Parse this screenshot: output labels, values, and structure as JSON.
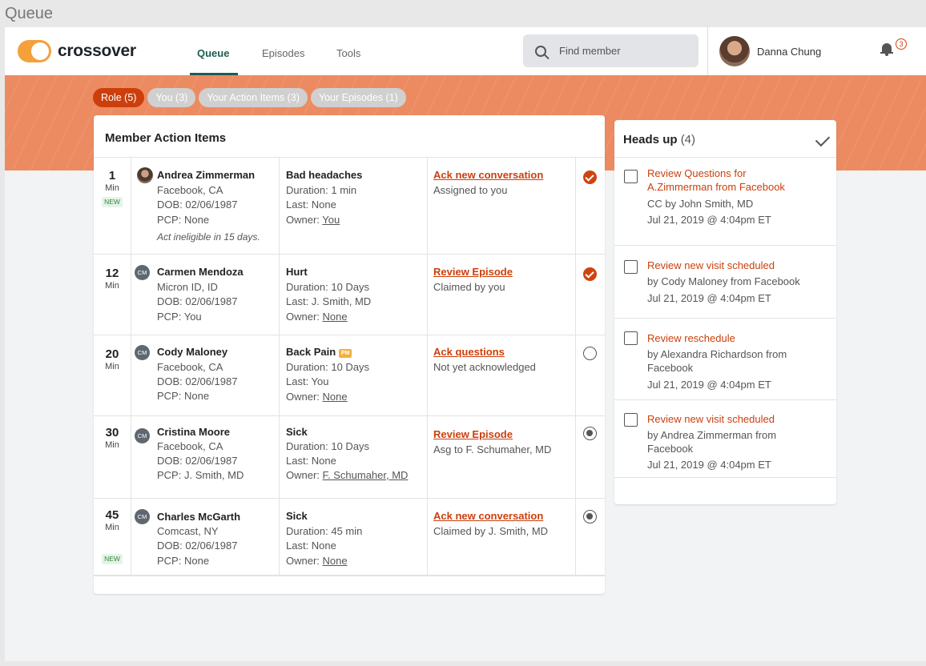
{
  "window_title": "Queue",
  "brand": {
    "name": "crossover",
    "accent": "#cc3f0c",
    "logo_color": "#f4a03b"
  },
  "nav": {
    "tabs": [
      {
        "label": "Queue",
        "active": true
      },
      {
        "label": "Episodes"
      },
      {
        "label": "Tools"
      }
    ]
  },
  "search": {
    "placeholder": "Find member"
  },
  "user": {
    "name": "Danna Chung"
  },
  "notifications": {
    "count": "3"
  },
  "filters": [
    {
      "label": "Role (5)",
      "active": true
    },
    {
      "label": "You (3)"
    },
    {
      "label": "Your Action Items (3)"
    },
    {
      "label": "Your Episodes (1)"
    }
  ],
  "main": {
    "title": "Member Action Items",
    "rows": [
      {
        "time": "1",
        "unit": "Min",
        "new": "NEW",
        "avatar": "photo",
        "name": "Andrea Zimmerman",
        "location": "Facebook, CA",
        "dob": "DOB: 02/06/1987",
        "pcp_label": "PCP: ",
        "pcp_value": "None",
        "note": "Act ineligible in 15 days.",
        "episode": "Bad headaches",
        "duration": "Duration: 1 min",
        "last": "Last: None",
        "owner_label": "Owner: ",
        "owner_value": "You",
        "action": "Ack new conversation",
        "action_status": "Assigned to you",
        "state": "done"
      },
      {
        "time": "12",
        "unit": "Min",
        "avatar": "CM",
        "name": "Carmen Mendoza",
        "location": "Micron ID, ID",
        "dob": "DOB: 02/06/1987",
        "pcp_label": "PCP: ",
        "pcp_value": "You",
        "episode": "Hurt",
        "duration": "Duration: 10 Days",
        "last": "Last: J. Smith, MD",
        "owner_label": "Owner: ",
        "owner_value": "None",
        "action": "Review Episode",
        "action_status": "Claimed by you",
        "state": "done"
      },
      {
        "time": "20",
        "unit": "Min",
        "avatar": "CM",
        "name": "Cody Maloney",
        "location": "Facebook, CA",
        "dob": "DOB: 02/06/1987",
        "pcp_label": "PCP: ",
        "pcp_value": "None",
        "episode": "Back Pain",
        "episode_badge": "PM",
        "duration": "Duration: 10 Days",
        "last": "Last: You",
        "owner_label": "Owner: ",
        "owner_value": "None",
        "action": "Ack questions",
        "action_status": "Not yet acknowledged",
        "state": "empty"
      },
      {
        "time": "30",
        "unit": "Min",
        "avatar": "CM",
        "name": "Cristina Moore",
        "location": "Facebook, CA",
        "dob": "DOB: 02/06/1987",
        "pcp_label": "PCP: ",
        "pcp_value": "J. Smith, MD",
        "episode": "Sick",
        "duration": "Duration: 10 Days",
        "last": "Last: None",
        "owner_label": "Owner: ",
        "owner_value": "F. Schumaher, MD",
        "action": "Review Episode",
        "action_status": "Asg to F. Schumaher, MD",
        "state": "partial"
      },
      {
        "time": "45",
        "unit": "Min",
        "new": "NEW",
        "avatar": "CM",
        "name": "Charles McGarth",
        "location": "Comcast, NY",
        "dob": "DOB: 02/06/1987",
        "pcp_label": "PCP: ",
        "pcp_value": "None",
        "episode": "Sick",
        "duration": "Duration: 45 min",
        "last": "Last: None",
        "owner_label": "Owner: ",
        "owner_value": "None",
        "action": "Ack new conversation",
        "action_status": "Claimed by J. Smith, MD",
        "state": "partial"
      }
    ]
  },
  "heads_up": {
    "title": "Heads up",
    "count": "(4)",
    "items": [
      {
        "title": "Review Questions for A.Zimmerman from Facebook",
        "by": "CC by John Smith, MD",
        "date": "Jul 21, 2019 @ 4:04pm ET"
      },
      {
        "title": "Review new visit scheduled",
        "by": "by Cody Maloney from Facebook",
        "date": "Jul 21, 2019 @ 4:04pm ET"
      },
      {
        "title": "Review reschedule",
        "by": "by Alexandra Richardson from Facebook",
        "date": "Jul 21, 2019 @ 4:04pm ET"
      },
      {
        "title": "Review new visit scheduled",
        "by": "by Andrea Zimmerman from Facebook",
        "date": "Jul 21, 2019 @ 4:04pm ET"
      }
    ]
  }
}
